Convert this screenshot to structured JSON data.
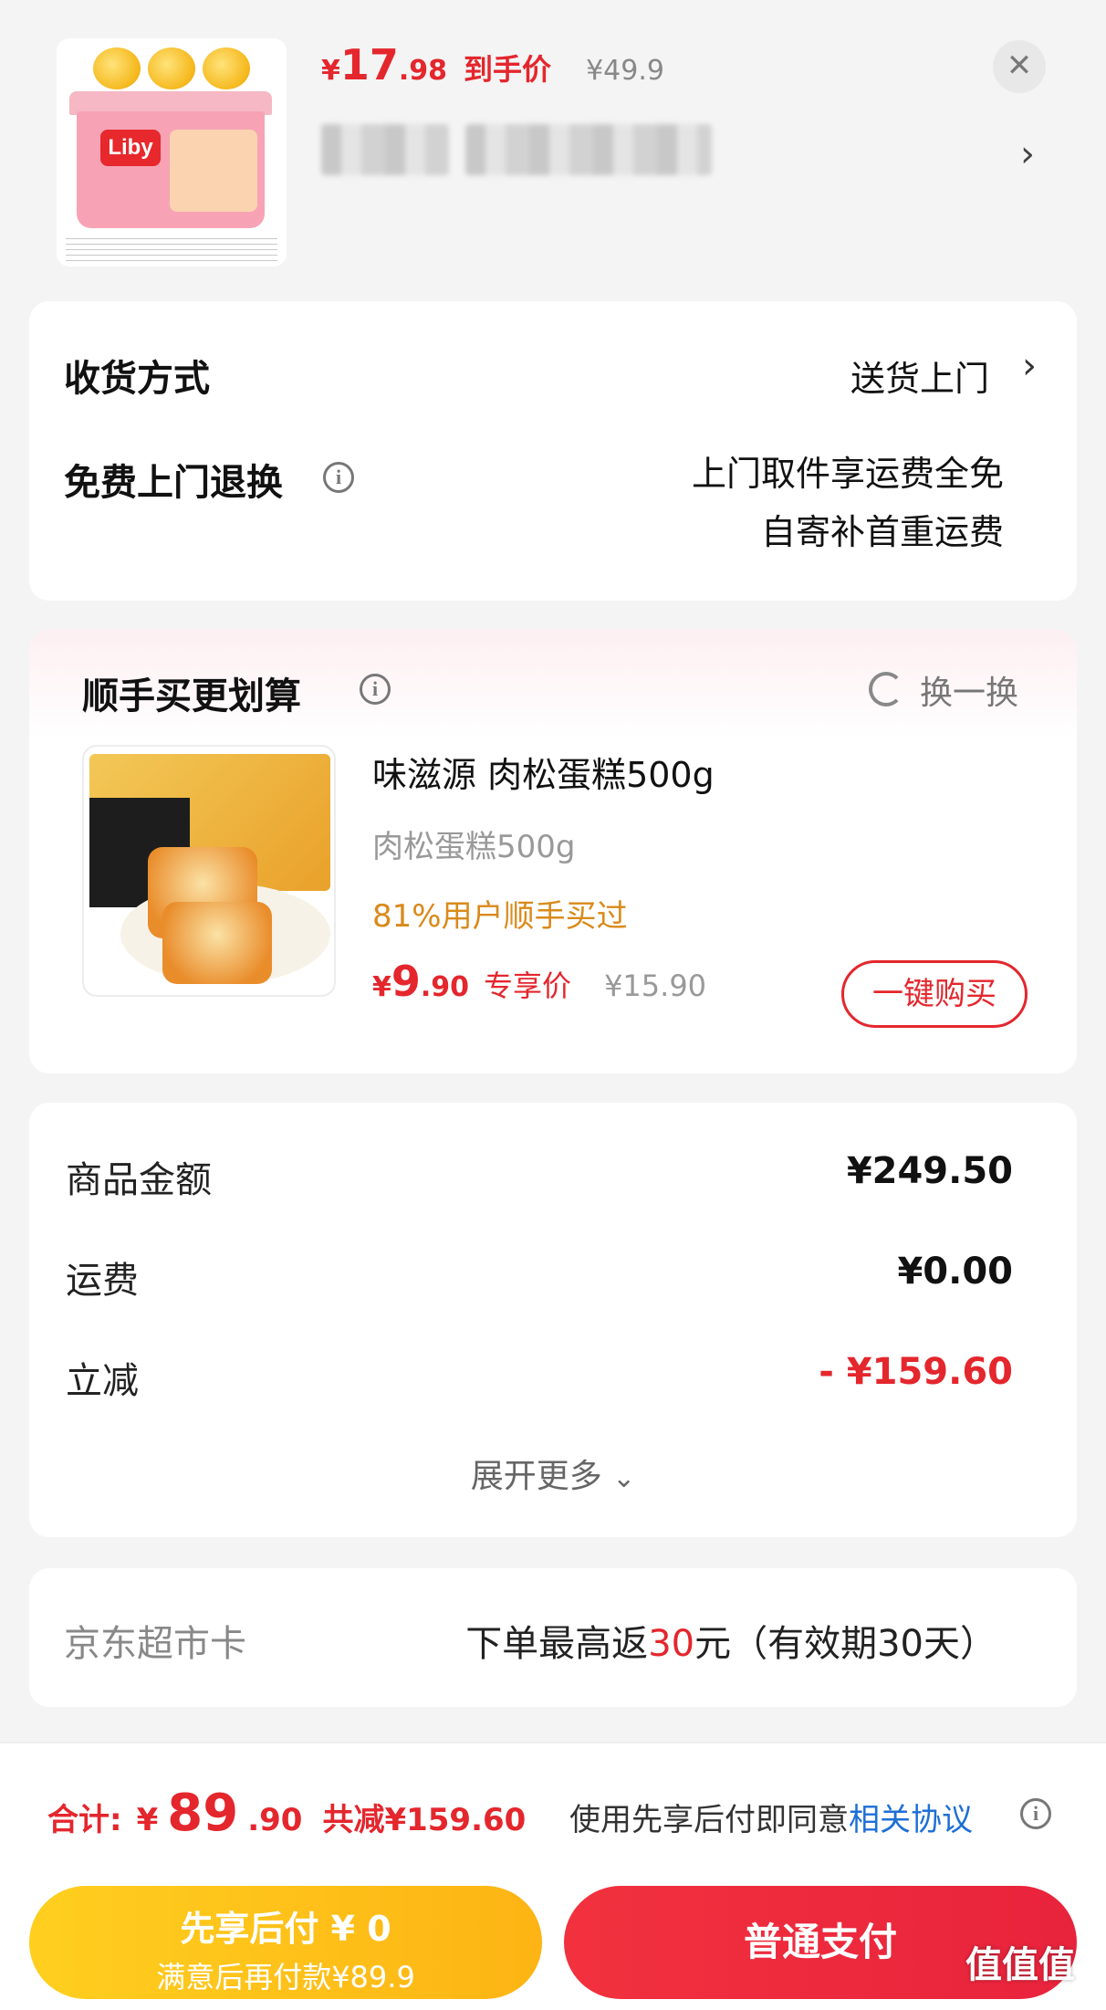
{
  "product": {
    "price_currency": "¥",
    "price_int": "17",
    "price_dec": ".98",
    "price_tag": "到手价",
    "original_price": "¥49.9",
    "brand_logo": "Liby"
  },
  "delivery": {
    "label": "收货方式",
    "value": "送货上门",
    "return_label": "免费上门退换",
    "return_line1": "上门取件享运费全免",
    "return_line2": "自寄补首重运费"
  },
  "bundle": {
    "title": "顺手买更划算",
    "swap_label": "换一换",
    "item_name": "味滋源 肉松蛋糕500g",
    "item_spec": "肉松蛋糕500g",
    "item_stat": "81%用户顺手买过",
    "price_currency": "¥",
    "price_int": "9",
    "price_dec": ".90",
    "price_tag": "专享价",
    "original_price": "¥15.90",
    "buy_label": "一键购买"
  },
  "summary": {
    "rows": [
      {
        "label": "商品金额",
        "value": "¥249.50"
      },
      {
        "label": "运费",
        "value": "¥0.00"
      },
      {
        "label": "立减",
        "value": "- ¥159.60"
      }
    ],
    "expand_label": "展开更多"
  },
  "card": {
    "label": "京东超市卡",
    "prefix": "下单最高返",
    "amount": "30",
    "suffix": "元（有效期30天）"
  },
  "footer": {
    "total_label": "合计:",
    "total_currency": "¥",
    "total_int": "89",
    "total_dec": ".90",
    "total_saved": "共减¥159.60",
    "agree_text": "使用先享后付即同意",
    "agree_link": "相关协议",
    "pay_later_title": "先享后付 ¥ 0",
    "pay_later_sub": "满意后再付款¥89.9",
    "pay_now": "普通支付"
  },
  "watermark": "值值值",
  "colors": {
    "accent_red": "#e4262d",
    "stat_orange": "#d98a1a",
    "link_blue": "#1e6fd6",
    "pay_later_yellow": "#ffcf1f"
  }
}
